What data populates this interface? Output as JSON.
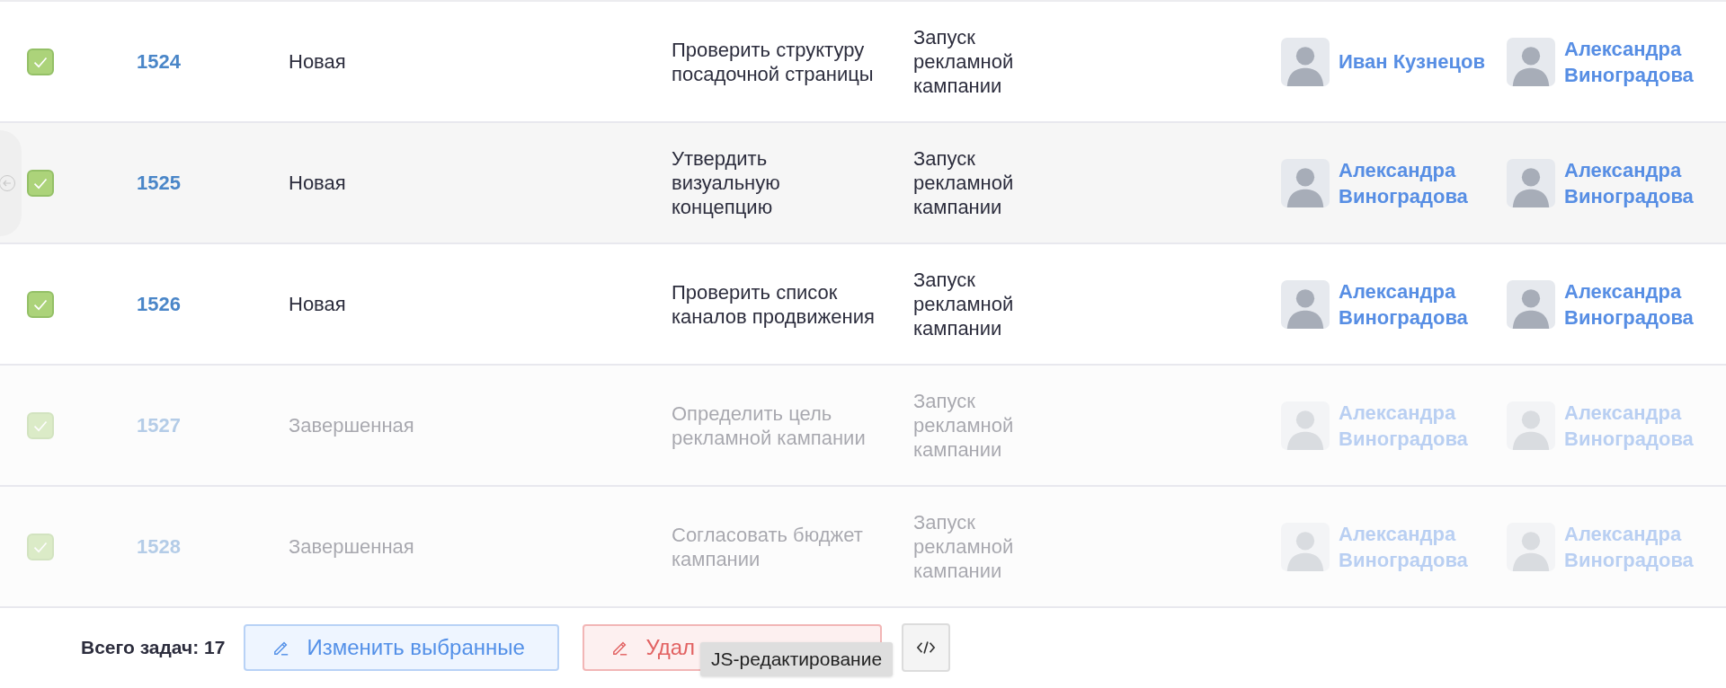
{
  "tasks": [
    {
      "id": "1524",
      "status": "Новая",
      "title": "Проверить структуру посадочной страницы",
      "project": "Запуск рекламной кампании",
      "assignee": "Иван Кузнецов",
      "author": "Александра Виноградова",
      "checked": true,
      "completed": false,
      "hovered": false
    },
    {
      "id": "1525",
      "status": "Новая",
      "title": "Утвердить визуальную концепцию",
      "project": "Запуск рекламной кампании",
      "assignee": "Александра Виноградова",
      "author": "Александра Виноградова",
      "checked": true,
      "completed": false,
      "hovered": true
    },
    {
      "id": "1526",
      "status": "Новая",
      "title": "Проверить список каналов продвижения",
      "project": "Запуск рекламной кампании",
      "assignee": "Александра Виноградова",
      "author": "Александра Виноградова",
      "checked": true,
      "completed": false,
      "hovered": false
    },
    {
      "id": "1527",
      "status": "Завершенная",
      "title": "Определить цель рекламной кампании",
      "project": "Запуск рекламной кампании",
      "assignee": "Александра Виноградова",
      "author": "Александра Виноградова",
      "checked": true,
      "completed": true,
      "hovered": false
    },
    {
      "id": "1528",
      "status": "Завершенная",
      "title": "Согласовать бюджет кампании",
      "project": "Запуск рекламной кампании",
      "assignee": "Александра Виноградова",
      "author": "Александра Виноградова",
      "checked": true,
      "completed": true,
      "hovered": false
    }
  ],
  "footer": {
    "total": "Всего задач: 17",
    "edit_button": "Изменить выбранные",
    "delete_button": "Удал",
    "tooltip": "JS-редактирование"
  }
}
